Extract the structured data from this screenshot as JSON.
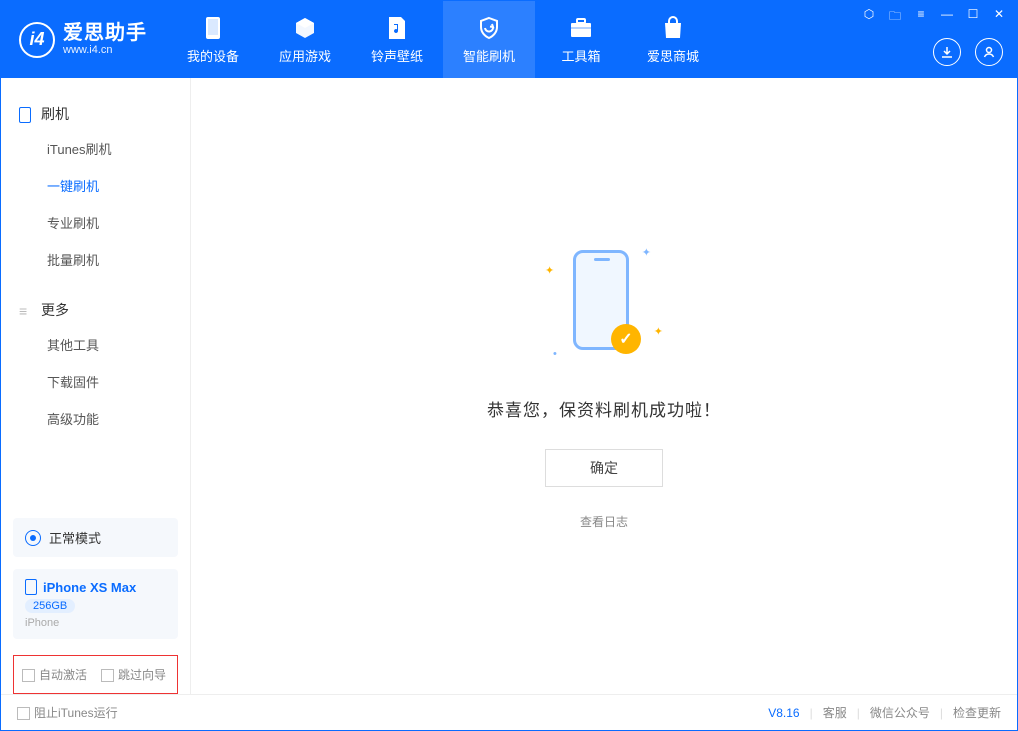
{
  "app": {
    "title": "爱思助手",
    "subtitle": "www.i4.cn"
  },
  "nav": {
    "items": [
      {
        "label": "我的设备"
      },
      {
        "label": "应用游戏"
      },
      {
        "label": "铃声壁纸"
      },
      {
        "label": "智能刷机"
      },
      {
        "label": "工具箱"
      },
      {
        "label": "爱思商城"
      }
    ]
  },
  "sidebar": {
    "section1_title": "刷机",
    "section1_items": [
      "iTunes刷机",
      "一键刷机",
      "专业刷机",
      "批量刷机"
    ],
    "section2_title": "更多",
    "section2_items": [
      "其他工具",
      "下载固件",
      "高级功能"
    ],
    "mode_label": "正常模式",
    "device_name": "iPhone XS Max",
    "device_capacity": "256GB",
    "device_type": "iPhone",
    "chk1_label": "自动激活",
    "chk2_label": "跳过向导"
  },
  "main": {
    "success_msg": "恭喜您，保资料刷机成功啦！",
    "ok_label": "确定",
    "log_link": "查看日志"
  },
  "footer": {
    "block_itunes": "阻止iTunes运行",
    "version": "V8.16",
    "links": [
      "客服",
      "微信公众号",
      "检查更新"
    ]
  }
}
